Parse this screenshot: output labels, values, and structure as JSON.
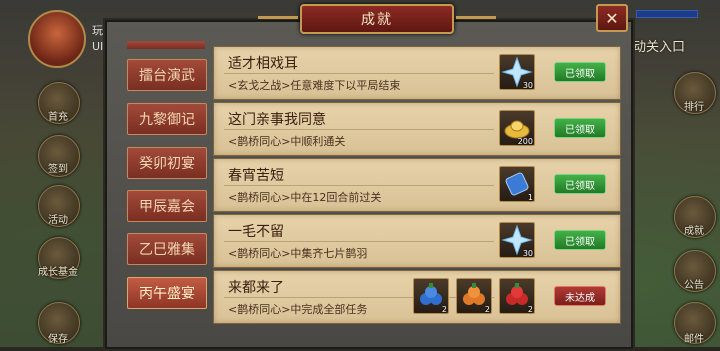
{
  "hud": {
    "player_label": "玩家",
    "uid_label": "UID",
    "activity_entry": "活动关入口",
    "left_buttons": [
      "首充",
      "签到",
      "活动",
      "成长基金",
      "保存"
    ],
    "right_buttons": [
      "排行",
      "成就",
      "公告",
      "邮件"
    ]
  },
  "panel": {
    "title": "成就",
    "close_symbol": "✕",
    "tabs": [
      {
        "label": "擂台演武",
        "active": false
      },
      {
        "label": "九黎御记",
        "active": false
      },
      {
        "label": "癸卯初宴",
        "active": false
      },
      {
        "label": "甲辰嘉会",
        "active": false
      },
      {
        "label": "乙巳雅集",
        "active": false
      },
      {
        "label": "丙午盛宴",
        "active": true
      }
    ],
    "achievements": [
      {
        "title": "适才相戏耳",
        "desc": "<玄戈之战>任意难度下以平局结束",
        "rewards": [
          {
            "icon": "ice-crystal-icon",
            "count": "30"
          }
        ],
        "status": "已领取"
      },
      {
        "title": "这门亲事我同意",
        "desc": "<鹊桥同心>中顺利通关",
        "rewards": [
          {
            "icon": "gold-ingot-icon",
            "count": "200"
          }
        ],
        "status": "已领取"
      },
      {
        "title": "春宵苦短",
        "desc": "<鹊桥同心>中在12回合前过关",
        "rewards": [
          {
            "icon": "blue-scroll-icon",
            "count": "1"
          }
        ],
        "status": "已领取"
      },
      {
        "title": "一毛不留",
        "desc": "<鹊桥同心>中集齐七片鹊羽",
        "rewards": [
          {
            "icon": "ice-crystal-icon",
            "count": "30"
          }
        ],
        "status": "已领取"
      },
      {
        "title": "来都来了",
        "desc": "<鹊桥同心>中完成全部任务",
        "rewards": [
          {
            "icon": "blue-fruit-icon",
            "count": "2"
          },
          {
            "icon": "orange-fruit-icon",
            "count": "2"
          },
          {
            "icon": "red-fruit-icon",
            "count": "2"
          }
        ],
        "status": "未达成"
      }
    ]
  },
  "colors": {
    "claimed": "#2f9a35",
    "pending": "#9a2a25",
    "accent": "#c49a52"
  }
}
